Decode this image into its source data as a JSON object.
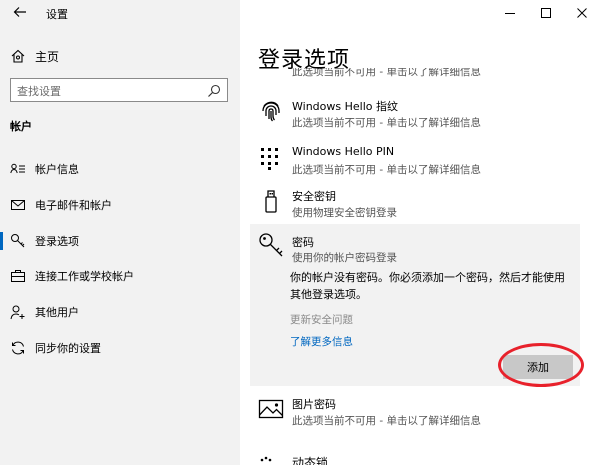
{
  "window": {
    "title": "设置"
  },
  "nav": {
    "home": "主页",
    "search_placeholder": "查找设置",
    "section": "帐户",
    "items": [
      {
        "label": "帐户信息",
        "icon": "account-info-icon"
      },
      {
        "label": "电子邮件和帐户",
        "icon": "mail-icon"
      },
      {
        "label": "登录选项",
        "icon": "key-icon"
      },
      {
        "label": "连接工作或学校帐户",
        "icon": "briefcase-icon"
      },
      {
        "label": "其他用户",
        "icon": "person-add-icon"
      },
      {
        "label": "同步你的设置",
        "icon": "sync-icon"
      }
    ]
  },
  "page": {
    "title": "登录选项",
    "partial_top_desc": "此选项当前不可用 - 单击以了解详细信息",
    "options": [
      {
        "name": "Windows Hello 指纹",
        "desc": "此选项当前不可用 - 单击以了解详细信息",
        "icon": "fingerprint-icon"
      },
      {
        "name": "Windows Hello PIN",
        "desc": "此选项当前不可用 - 单击以了解详细信息",
        "icon": "pin-keypad-icon"
      },
      {
        "name": "安全密钥",
        "desc": "使用物理安全密钥登录",
        "icon": "usb-key-icon"
      }
    ],
    "password": {
      "name": "密码",
      "desc": "使用你的帐户密码登录",
      "message": "你的帐户没有密码。你必须添加一个密码，然后才能使用其他登录选项。",
      "update_link": "更新安全问题",
      "learn_more": "了解更多信息",
      "add_button": "添加"
    },
    "picture_password": {
      "name": "图片密码",
      "desc": "此选项当前不可用 - 单击以了解详细信息"
    },
    "partial_bottom_name": "动态锁"
  }
}
